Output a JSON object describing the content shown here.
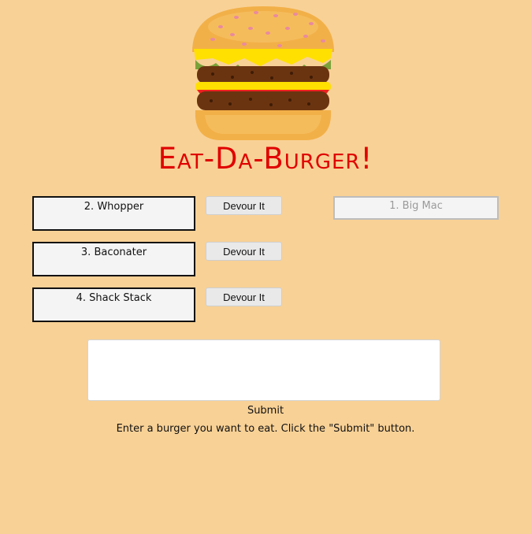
{
  "header": {
    "logo_icon": "burger-icon",
    "title": "Eat-Da-Burger!"
  },
  "burgers_to_devour": [
    {
      "label": "2. Whopper",
      "button_label": "Devour It"
    },
    {
      "label": "3. Baconater",
      "button_label": "Devour It"
    },
    {
      "label": "4. Shack Stack",
      "button_label": "Devour It"
    }
  ],
  "devoured_burgers": [
    {
      "label": "1. Big Mac"
    }
  ],
  "form": {
    "textarea_value": "",
    "submit_label": "Submit",
    "instructions": "Enter a burger you want to eat. Click the \"Submit\" button."
  },
  "colors": {
    "background": "#f8d196",
    "title": "#e00000"
  }
}
